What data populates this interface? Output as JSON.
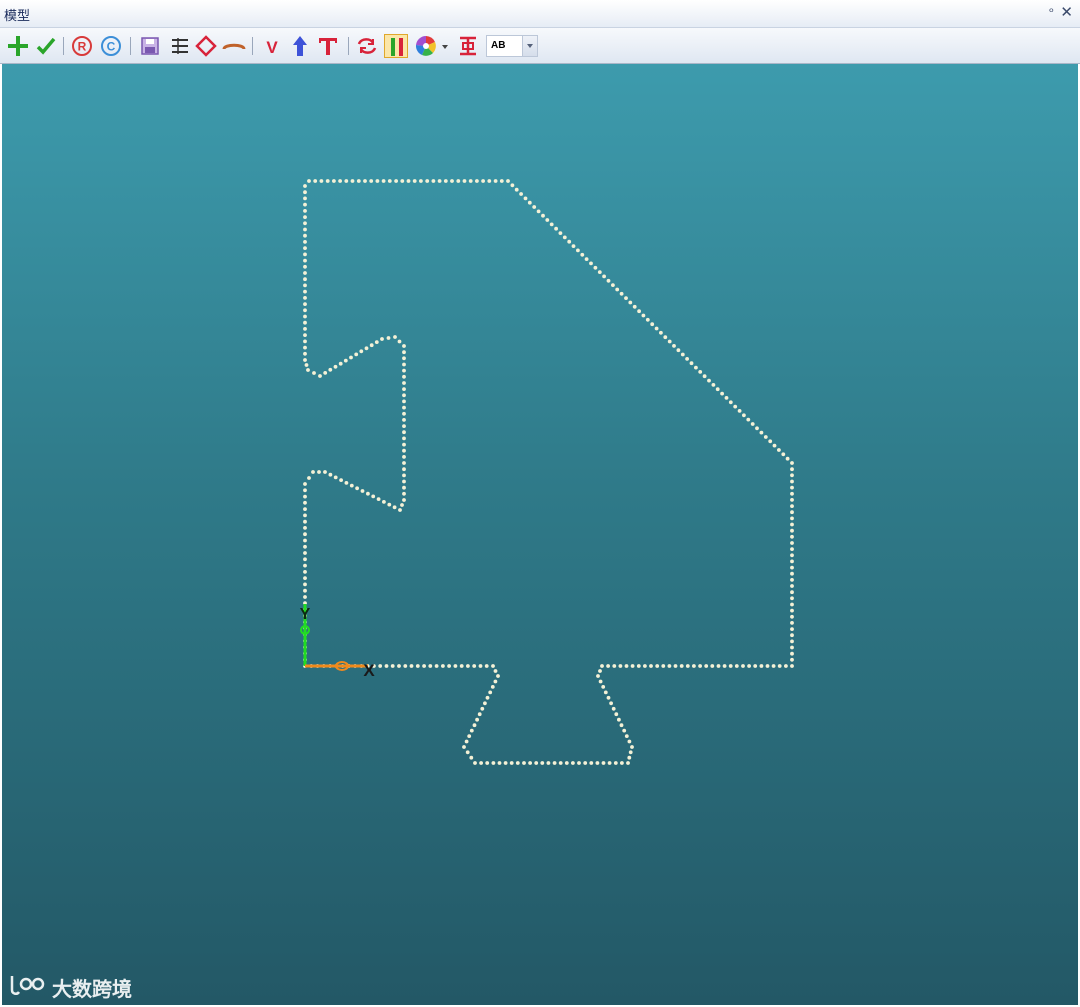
{
  "window": {
    "title": "模型",
    "pin_glyph": "ᵒ",
    "close_glyph": "✕"
  },
  "toolbar": {
    "tools": [
      {
        "name": "add-icon"
      },
      {
        "name": "check-icon"
      },
      {
        "name": "record-r-icon"
      },
      {
        "name": "record-c-icon"
      },
      {
        "name": "save-icon"
      },
      {
        "name": "list-icon"
      },
      {
        "name": "diamond-shape-icon"
      },
      {
        "name": "arc-icon"
      },
      {
        "name": "vertex-v-icon"
      },
      {
        "name": "arrow-up-icon"
      },
      {
        "name": "text-t-icon"
      },
      {
        "name": "swap-icon"
      },
      {
        "name": "parallel-bars-icon"
      },
      {
        "name": "color-wheel-icon"
      },
      {
        "name": "dimension-icon"
      }
    ],
    "dropdown_value": "AB"
  },
  "viewport": {
    "axis_y_label": "Y",
    "axis_x_label": "X",
    "colors": {
      "path_dots": "#f4f1d6",
      "axis_y": "#22dd22",
      "axis_x": "#f08a1c"
    }
  },
  "watermark": {
    "text": "大数跨境"
  }
}
